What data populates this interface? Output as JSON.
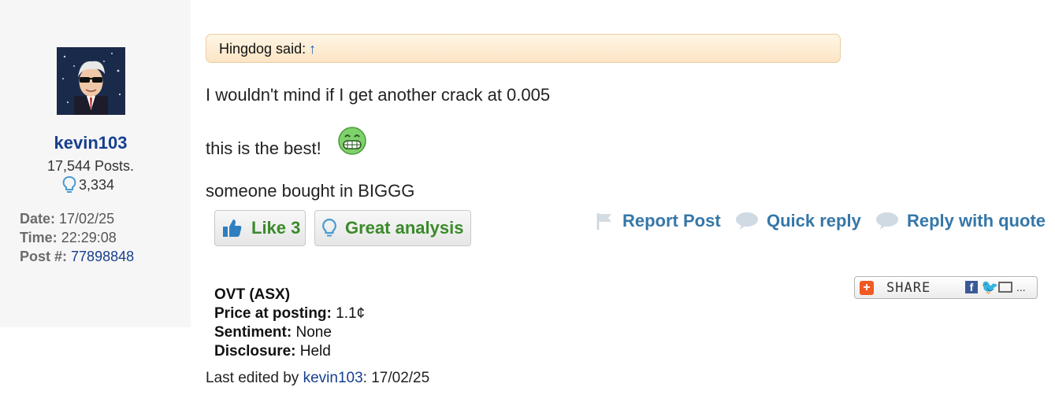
{
  "user": {
    "username": "kevin103",
    "posts": "17,544 Posts.",
    "likes": "3,334",
    "avatar": "avatar-sunglasses-icon"
  },
  "post_meta": {
    "date_label": "Date:",
    "date": "17/02/25",
    "time_label": "Time:",
    "time": "22:29:08",
    "postno_label": "Post #:",
    "postno": "77898848"
  },
  "quote": {
    "author_text": "Hingdog said:",
    "arrow": "↑"
  },
  "body": {
    "line1": "I wouldn't mind if I get another crack at 0.005",
    "line2": "this is the best!",
    "line3": "someone bought in BIGGG"
  },
  "buttons": {
    "like": "Like 3",
    "great": "Great analysis"
  },
  "actions": {
    "report": "Report Post",
    "quick": "Quick reply",
    "quote": "Reply with quote"
  },
  "share": {
    "label": "SHARE",
    "dots": "..."
  },
  "stock": {
    "code": "OVT (ASX)",
    "price_label": "Price at posting:",
    "price": "1.1¢",
    "sentiment_label": "Sentiment:",
    "sentiment": "None",
    "disclosure_label": "Disclosure:",
    "disclosure": "Held"
  },
  "edited": {
    "prefix": "Last edited by",
    "user": "kevin103",
    "suffix": ": 17/02/25"
  },
  "colors": {
    "link": "#173f8f",
    "action": "#3577a8",
    "like_green": "#3b8a2a",
    "quote_bg": "#fce5c4"
  }
}
